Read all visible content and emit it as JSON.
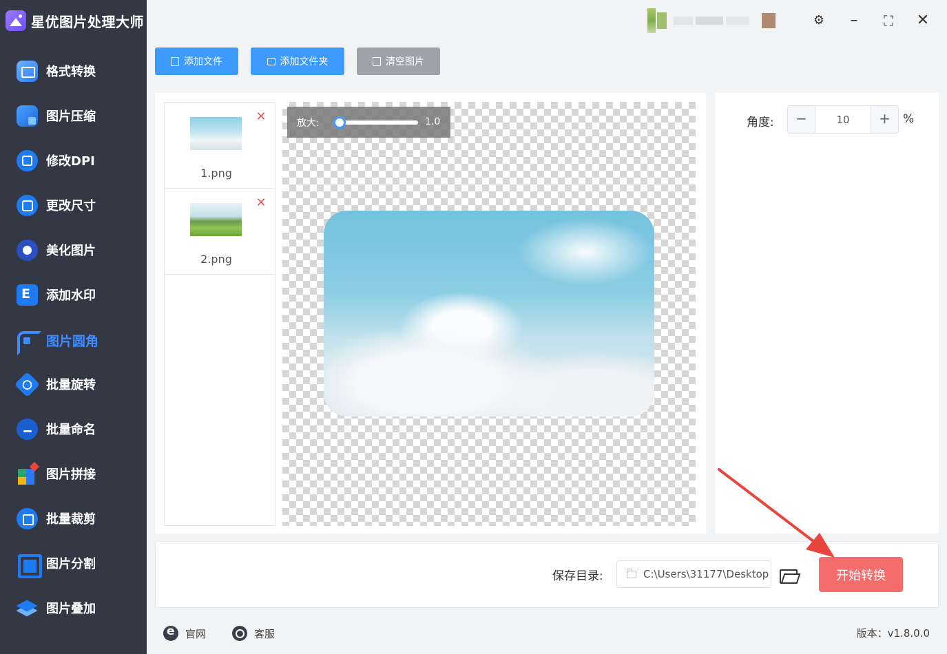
{
  "app": {
    "title": "星优图片处理大师",
    "version_label": "版本：v1.8.0.0"
  },
  "sidebar": {
    "items": [
      {
        "label": "格式转换",
        "icon": "format-convert-icon"
      },
      {
        "label": "图片压缩",
        "icon": "compress-icon"
      },
      {
        "label": "修改DPI",
        "icon": "dpi-icon"
      },
      {
        "label": "更改尺寸",
        "icon": "resize-icon"
      },
      {
        "label": "美化图片",
        "icon": "beautify-icon"
      },
      {
        "label": "添加水印",
        "icon": "watermark-icon"
      },
      {
        "label": "图片圆角",
        "icon": "rounded-corner-icon",
        "active": true
      },
      {
        "label": "批量旋转",
        "icon": "rotate-icon"
      },
      {
        "label": "批量命名",
        "icon": "rename-icon"
      },
      {
        "label": "图片拼接",
        "icon": "stitch-icon"
      },
      {
        "label": "批量裁剪",
        "icon": "crop-icon"
      },
      {
        "label": "图片分割",
        "icon": "split-icon"
      },
      {
        "label": "图片叠加",
        "icon": "overlay-icon"
      }
    ]
  },
  "toolbar": {
    "add_file": "添加文件",
    "add_folder": "添加文件夹",
    "clear_images": "清空图片"
  },
  "files": [
    {
      "name": "1.png"
    },
    {
      "name": "2.png"
    }
  ],
  "preview": {
    "zoom_label": "放大:",
    "zoom_value": "1.0"
  },
  "settings": {
    "angle_label": "角度:",
    "angle_value": "10",
    "angle_unit": "%"
  },
  "output": {
    "save_dir_label": "保存目录:",
    "save_dir_value": "C:\\Users\\31177\\Desktop",
    "start_button": "开始转换"
  },
  "footer": {
    "website": "官网",
    "support": "客服"
  },
  "colors": {
    "sidebar_bg": "#343844",
    "active_nav": "#3d8bff",
    "primary_button": "#3d9bff",
    "start_button": "#f56c6c",
    "delete_icon": "#f0565b",
    "arrow": "#e8453c"
  }
}
